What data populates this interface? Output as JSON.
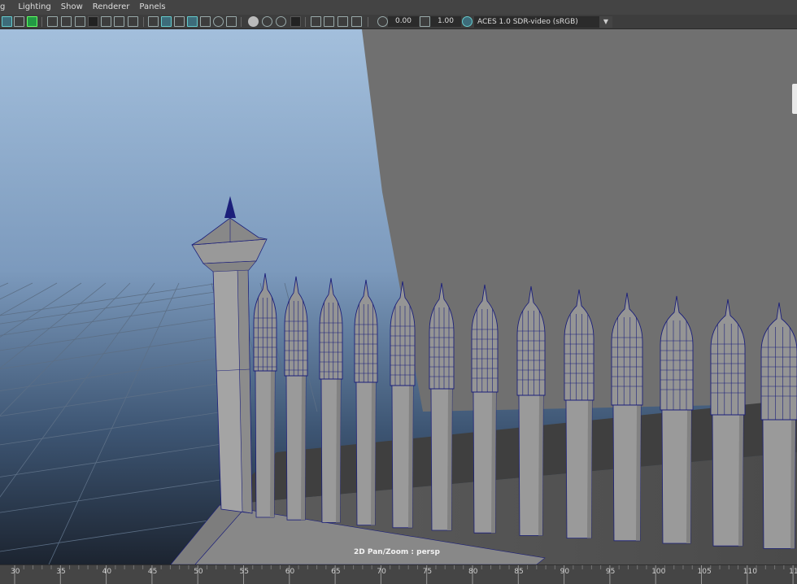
{
  "menubar": {
    "items": [
      {
        "label": "g"
      },
      {
        "label": "Lighting"
      },
      {
        "label": "Show"
      },
      {
        "label": "Renderer"
      },
      {
        "label": "Panels"
      }
    ]
  },
  "toolbar": {
    "exposure_value": "0.00",
    "gamma_value": "1.00",
    "color_space": "ACES 1.0 SDR-video (sRGB)"
  },
  "viewport": {
    "hud_label": "2D Pan/Zoom : persp",
    "camera": "persp"
  },
  "timeline": {
    "ticks": [
      "30",
      "35",
      "40",
      "45",
      "50",
      "55",
      "60",
      "65",
      "70",
      "75",
      "80",
      "85",
      "90",
      "95",
      "100",
      "105",
      "110",
      "11"
    ]
  },
  "colors": {
    "ui_background": "#444444",
    "viewport_gradient_top": "#a3bfdc",
    "viewport_gradient_bottom": "#1c2430",
    "wall": "#707070",
    "fence_face": "#9a9a9a",
    "wireframe": "#1b1f7a",
    "accent": "#5fb6c8"
  }
}
